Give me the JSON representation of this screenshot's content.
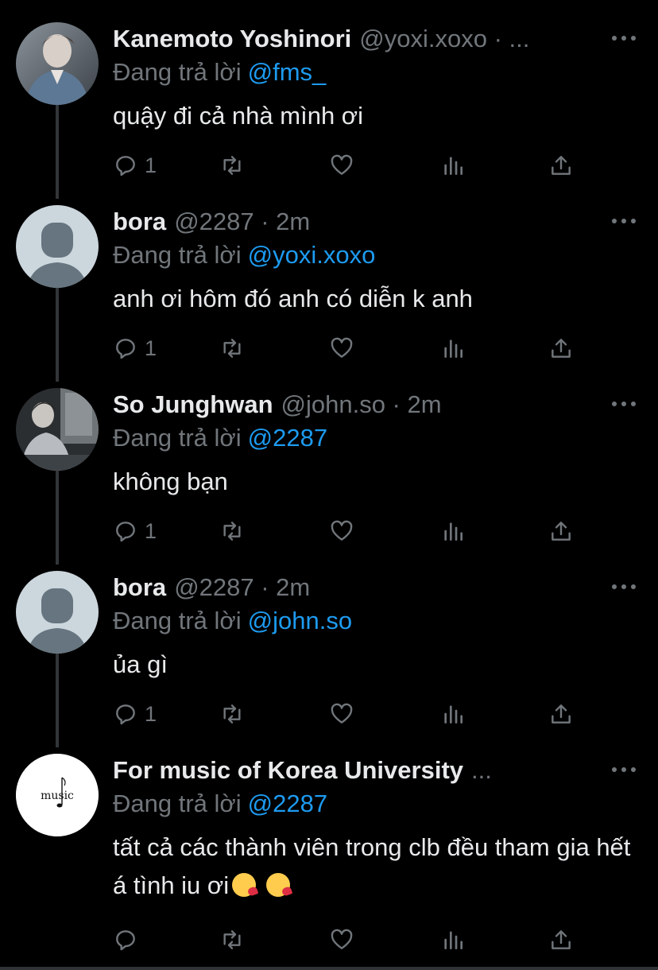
{
  "tweets": [
    {
      "name": "Kanemoto Yoshinori",
      "meta": "@yoxi.xoxo · ...",
      "replying_label": "Đang trả lời",
      "mention": "@fms_",
      "text": "quậy đi cả nhà mình ơi",
      "reply_count": "1",
      "avatar": "photo-person-icon"
    },
    {
      "name": "bora",
      "meta": "@2287 · 2m",
      "replying_label": "Đang trả lời",
      "mention": "@yoxi.xoxo",
      "text": "anh ơi hôm đó anh có diễn k anh",
      "reply_count": "1",
      "avatar": "default-avatar-icon"
    },
    {
      "name": "So Junghwan",
      "meta": "@john.so · 2m",
      "replying_label": "Đang trả lời",
      "mention": "@2287",
      "text": "không bạn",
      "reply_count": "1",
      "avatar": "photo-person-icon"
    },
    {
      "name": "bora",
      "meta": "@2287 · 2m",
      "replying_label": "Đang trả lời",
      "mention": "@john.so",
      "text": "ủa gì",
      "reply_count": "1",
      "avatar": "default-avatar-icon"
    },
    {
      "name": "For music of Korea University",
      "meta": "...",
      "replying_label": "Đang trả lời",
      "mention": "@2287",
      "text": "tất cả các thành viên trong clb đều tham gia hết á tình iu ơi",
      "reply_count": "",
      "avatar": "music-logo-icon",
      "logo_text": "music",
      "emojis": [
        "kissing-heart-emoji",
        "kissing-heart-emoji"
      ]
    }
  ],
  "colors": {
    "background": "#000000",
    "text": "#e7e9ea",
    "muted": "#71767b",
    "link": "#1d9bf0"
  }
}
